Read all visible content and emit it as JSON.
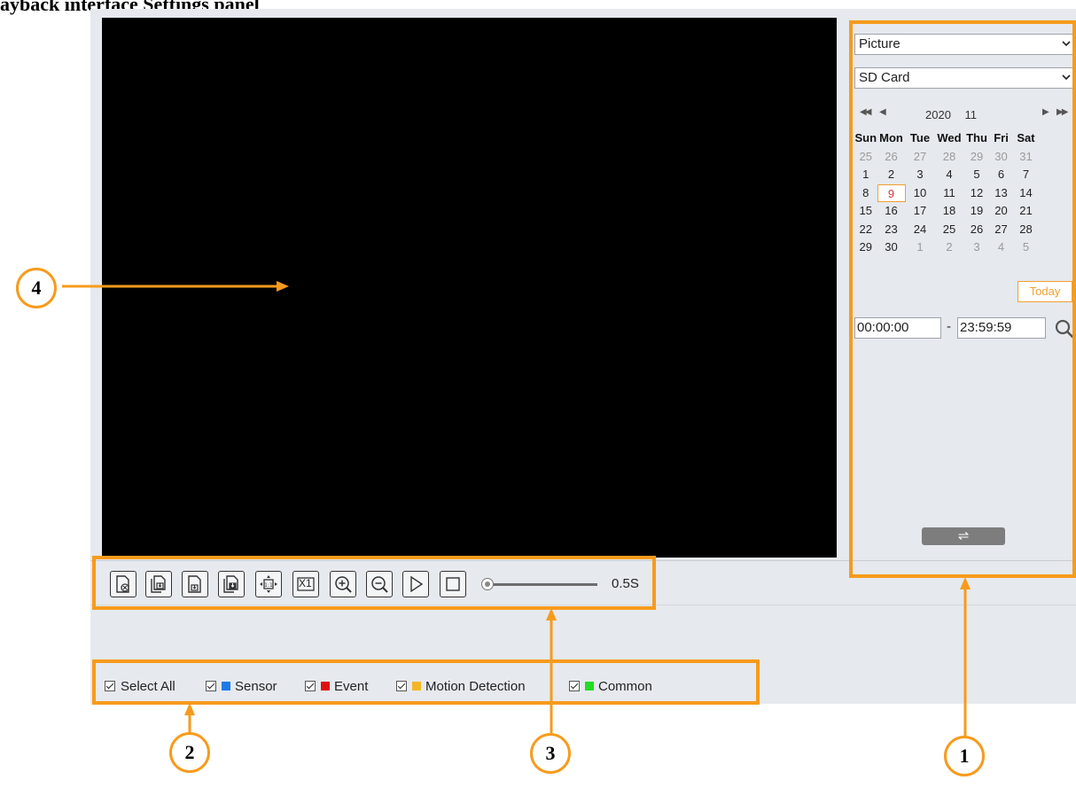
{
  "page_title": "ayback interface Settings panel",
  "side_panel": {
    "type_select": "Picture",
    "storage_select": "SD Card",
    "calendar": {
      "year": "2020",
      "month": "11",
      "prev_year_icon": "double-left-arrow-icon",
      "prev_month_icon": "left-arrow-icon",
      "next_month_icon": "right-arrow-icon",
      "next_year_icon": "double-right-arrow-icon",
      "weekdays": [
        "Sun",
        "Mon",
        "Tue",
        "Wed",
        "Thu",
        "Fri",
        "Sat"
      ],
      "weeks": [
        [
          "25",
          "26",
          "27",
          "28",
          "29",
          "30",
          "31"
        ],
        [
          "1",
          "2",
          "3",
          "4",
          "5",
          "6",
          "7"
        ],
        [
          "8",
          "9",
          "10",
          "11",
          "12",
          "13",
          "14"
        ],
        [
          "15",
          "16",
          "17",
          "18",
          "19",
          "20",
          "21"
        ],
        [
          "22",
          "23",
          "24",
          "25",
          "26",
          "27",
          "28"
        ],
        [
          "29",
          "30",
          "1",
          "2",
          "3",
          "4",
          "5"
        ]
      ],
      "selected_day": "9",
      "today_label": "Today"
    },
    "start_time": "00:00:00",
    "separator": "-",
    "end_time": "23:59:59",
    "search_icon": "search-icon",
    "toggle_label": "⇌"
  },
  "toolbar": {
    "icons": [
      "close-picture-icon",
      "save-pictures-icon",
      "save-picture-icon",
      "save-all-icon",
      "fit-screen-icon",
      "original-size-icon",
      "zoom-in-icon",
      "zoom-out-icon",
      "play-icon",
      "stop-icon"
    ],
    "x1_label": "X1",
    "speed": "0.5S"
  },
  "filters": [
    {
      "label": "Select All",
      "checked": true,
      "color": ""
    },
    {
      "label": "Sensor",
      "checked": true,
      "color": "#1e7be6"
    },
    {
      "label": "Event",
      "checked": true,
      "color": "#e01010"
    },
    {
      "label": "Motion Detection",
      "checked": true,
      "color": "#f2b628"
    },
    {
      "label": "Common",
      "checked": true,
      "color": "#22dd22"
    }
  ],
  "callouts": [
    "4",
    "2",
    "3",
    "1"
  ],
  "colors": {
    "highlight": "#f79b1c",
    "video": "#000000",
    "panel_bg": "#e6e9ee"
  }
}
